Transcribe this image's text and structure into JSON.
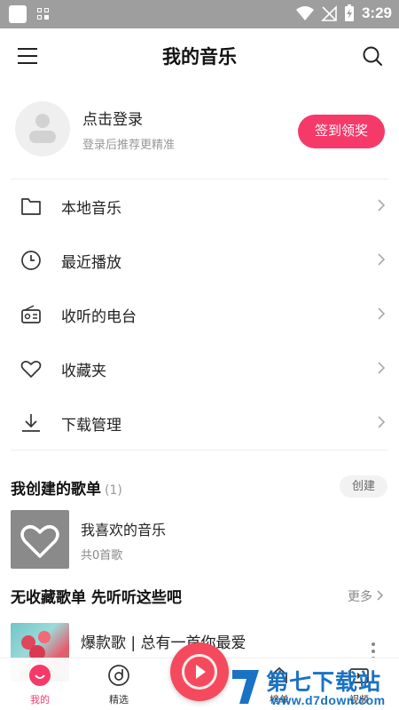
{
  "status_bar": {
    "time": "3:29"
  },
  "header": {
    "title": "我的音乐"
  },
  "profile": {
    "title": "点击登录",
    "subtitle": "登录后推荐更精准",
    "signin_button": "签到领奖"
  },
  "menu": [
    {
      "label": "本地音乐",
      "icon": "folder-icon"
    },
    {
      "label": "最近播放",
      "icon": "clock-icon"
    },
    {
      "label": "收听的电台",
      "icon": "radio-icon"
    },
    {
      "label": "收藏夹",
      "icon": "heart-icon"
    },
    {
      "label": "下载管理",
      "icon": "download-icon"
    }
  ],
  "created_playlists": {
    "title": "我创建的歌单",
    "count": "(1)",
    "create_button": "创建",
    "items": [
      {
        "name": "我喜欢的音乐",
        "count": "共0首歌"
      }
    ]
  },
  "recommend": {
    "title": "无收藏歌单 先听听这些吧",
    "more": "更多",
    "items": [
      {
        "title": "爆款歌 | 总有一首你最爱"
      }
    ]
  },
  "bottom_nav": {
    "items": [
      {
        "label": "我的",
        "icon": "smile-icon",
        "active": true
      },
      {
        "label": "精选",
        "icon": "disc-icon",
        "active": false
      },
      {
        "label": "榜单",
        "icon": "chart-icon",
        "active": false
      },
      {
        "label": "视频",
        "icon": "video-icon",
        "active": false
      }
    ]
  },
  "watermark": {
    "text": "第七下载站",
    "url": "www.d7down.com"
  },
  "colors": {
    "accent": "#f53a6a",
    "watermark": "#1a72c4"
  }
}
